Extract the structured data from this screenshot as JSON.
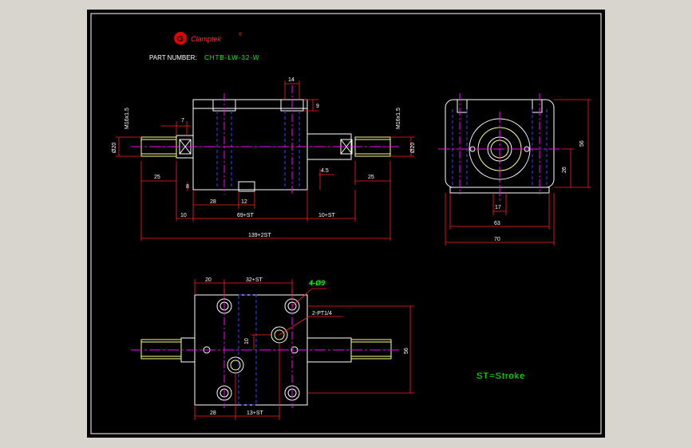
{
  "brand": {
    "logo_letter": "G",
    "name": "Clamptek",
    "reg": "®"
  },
  "part": {
    "label": "PART NUMBER:",
    "value": "CHTB-LW-32-W"
  },
  "legend": {
    "stroke_note": "ST=Stroke"
  },
  "dims": {
    "d14": "14",
    "d9": "9",
    "d7": "7",
    "d4_5": "4.5",
    "m16_left": "M16x1.5",
    "m16_right": "M16x1.5",
    "dia20_left": "Ø20",
    "dia20_right": "Ø20",
    "d25_left": "25",
    "d25_right": "25",
    "d8": "8",
    "d28_front": "28",
    "d12": "12",
    "d10_left": "10",
    "d69st": "69+ST",
    "d10st": "10+ST",
    "d139": "139+2ST",
    "side_56": "56",
    "side_26": "26",
    "side_17": "17",
    "side_63": "63",
    "side_70": "70",
    "top_20": "20",
    "top_32st": "32+ST",
    "top_4hole": "4-Ø9",
    "top_port": "2-PT1/4",
    "top_10": "10",
    "top_56": "56",
    "top_28": "28",
    "top_13st": "13+ST"
  },
  "colors": {
    "dim": "#ff2020",
    "geo": "#ffffff",
    "center": "#ff00ff",
    "hidden": "#4040ff",
    "text": "#00ff00",
    "thread": "#ffff80"
  }
}
